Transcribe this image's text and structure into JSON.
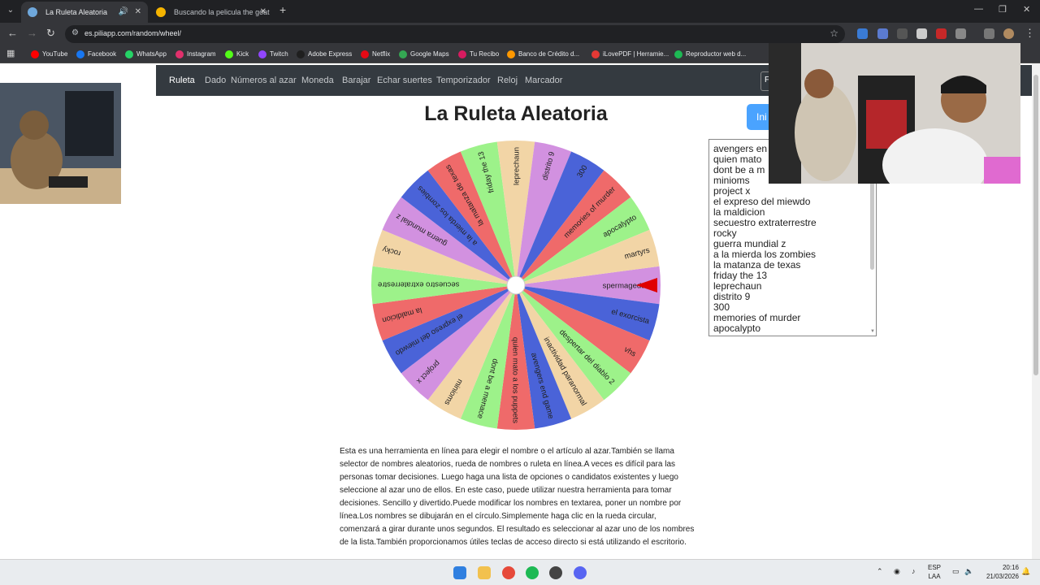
{
  "browser": {
    "tabs": [
      {
        "title": "La Ruleta Aleatoria",
        "active": true
      },
      {
        "title": "Buscando la pelicula the goat",
        "active": false
      }
    ],
    "url": "es.piliapp.com/random/wheel/",
    "bookmarks": [
      "YouTube",
      "Facebook",
      "WhatsApp",
      "Instagram",
      "Kick",
      "Twitch",
      "Adobe Express",
      "Netflix",
      "Google Maps",
      "Tu Recibo",
      "Banco de Crédito d...",
      "iLovePDF | Herramie...",
      "Reproductor web d..."
    ],
    "bookmark_colors": [
      "#ff0000",
      "#1877f2",
      "#25d366",
      "#e1306c",
      "#53fc18",
      "#9146ff",
      "#1f1f1f",
      "#e50914",
      "#34a853",
      "#d81b60",
      "#ff9800",
      "#e53935",
      "#1db954"
    ]
  },
  "site": {
    "nav": [
      "Ruleta",
      "Dado",
      "Números al azar",
      "Moneda",
      "Barajar",
      "Echar suertes",
      "Temporizador",
      "Reloj",
      "Marcador"
    ],
    "nav_box": "F",
    "title": "La Ruleta Aleatoria",
    "start_label": "Ini",
    "names": [
      "avengers en",
      "quien mato",
      "dont be a m",
      "minioms",
      "project x",
      "el expreso del miewdo",
      "la maldicion",
      "secuestro extraterrestre",
      "rocky",
      "guerra mundial z",
      "a la mierda los zombies",
      "la matanza de texas",
      "friday the 13",
      "leprechaun",
      "distrito 9",
      "300",
      "memories of murder",
      "apocalypto",
      "martyrs"
    ],
    "description": "Esta es una herramienta en línea para elegir el nombre o el artículo al azar.También se llama selector de nombres aleatorios, rueda de nombres o ruleta en línea.A veces es difícil para las personas tomar decisiones. Luego haga una lista de opciones o candidatos existentes y luego seleccione al azar uno de ellos. En este caso, puede utilizar nuestra herramienta para tomar decisiones. Sencillo y divertido.Puede modificar los nombres en textarea, poner un nombre por línea.Los nombres se dibujarán en el círculo.Simplemente haga clic en la rueda circular, comenzará a girar durante unos segundos. El resultado es seleccionar al azar uno de los nombres de la lista.También proporcionamos útiles teclas de acceso directo si está utilizando el escritorio."
  },
  "wheel": {
    "segments": [
      {
        "label": "spermageddon",
        "color": "#d291e0"
      },
      {
        "label": "el exorcista",
        "color": "#4a63d8"
      },
      {
        "label": "vhs",
        "color": "#ef6a6a"
      },
      {
        "label": "despertar del diablo 2",
        "color": "#9df28a"
      },
      {
        "label": "inactividad paranormal",
        "color": "#f2d5a6"
      },
      {
        "label": "avengers end game",
        "color": "#4a63d8"
      },
      {
        "label": "quien mato a los puppets",
        "color": "#ef6a6a"
      },
      {
        "label": "dont be a menace",
        "color": "#9df28a"
      },
      {
        "label": "minioms",
        "color": "#f2d5a6"
      },
      {
        "label": "project x",
        "color": "#d291e0"
      },
      {
        "label": "el expreso del miewdo",
        "color": "#4a63d8"
      },
      {
        "label": "la maldicion",
        "color": "#ef6a6a"
      },
      {
        "label": "secuestro extraterrestre",
        "color": "#9df28a"
      },
      {
        "label": "rocky",
        "color": "#f2d5a6"
      },
      {
        "label": "guerra mundial z",
        "color": "#d291e0"
      },
      {
        "label": "a la mierda los zombies",
        "color": "#4a63d8"
      },
      {
        "label": "la matanza de texas",
        "color": "#ef6a6a"
      },
      {
        "label": "friday the 13",
        "color": "#9df28a"
      },
      {
        "label": "leprechaun",
        "color": "#f2d5a6"
      },
      {
        "label": "distrito 9",
        "color": "#d291e0"
      },
      {
        "label": "300",
        "color": "#4a63d8"
      },
      {
        "label": "memories of murder",
        "color": "#ef6a6a"
      },
      {
        "label": "apocalypto",
        "color": "#9df28a"
      },
      {
        "label": "martyrs",
        "color": "#f2d5a6"
      }
    ],
    "pointer_color": "#e00000"
  },
  "taskbar": {
    "lang_top": "ESP",
    "lang_bottom": "LAA",
    "time": "20:16",
    "date": "21/03/2026"
  }
}
